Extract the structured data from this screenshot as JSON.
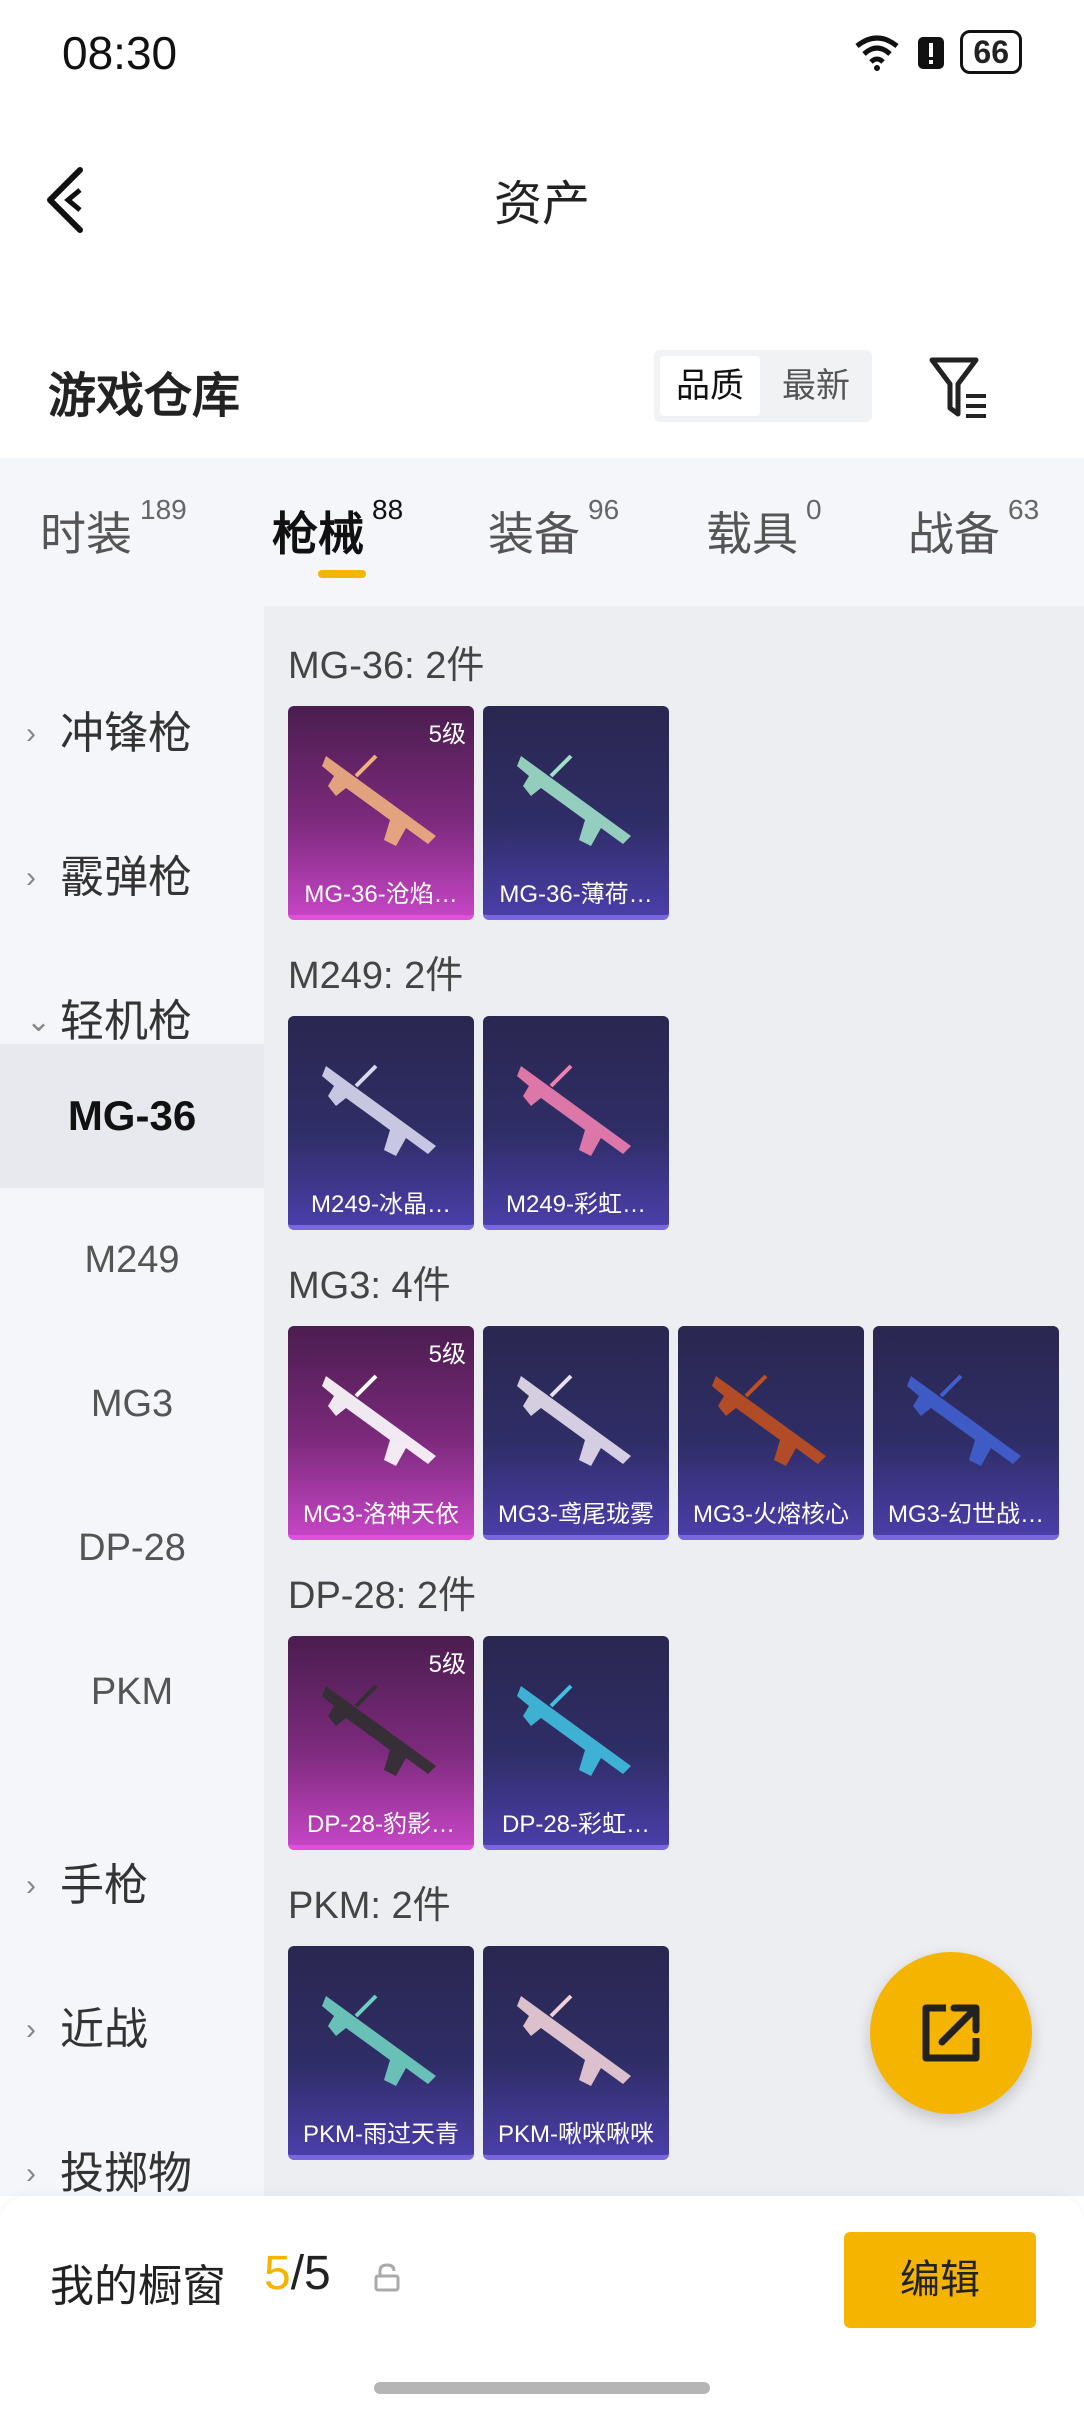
{
  "status_bar": {
    "time": "08:30",
    "battery": "66"
  },
  "header": {
    "title": "资产"
  },
  "store": {
    "title": "游戏仓库",
    "sort_options": [
      "品质",
      "最新"
    ],
    "active_sort": "品质"
  },
  "tabs": [
    {
      "label": "时装",
      "count": "189"
    },
    {
      "label": "枪械",
      "count": "88"
    },
    {
      "label": "装备",
      "count": "96"
    },
    {
      "label": "载具",
      "count": "0"
    },
    {
      "label": "战备",
      "count": "63"
    }
  ],
  "active_tab": "枪械",
  "sidebar": {
    "categories_top": [
      "冲锋枪",
      "霰弹枪",
      "轻机枪"
    ],
    "subs": [
      "MG-36",
      "M249",
      "MG3",
      "DP-28",
      "PKM"
    ],
    "active_sub": "MG-36",
    "categories_bottom": [
      "手枪",
      "近战",
      "投掷物"
    ]
  },
  "groups": [
    {
      "title": "MG-36: 2件",
      "items": [
        {
          "name": "MG-36-沧焰…",
          "level": "5级",
          "quality": "gold"
        },
        {
          "name": "MG-36-薄荷…",
          "level": "",
          "quality": "purple"
        }
      ]
    },
    {
      "title": "M249: 2件",
      "items": [
        {
          "name": "M249-冰晶…",
          "level": "",
          "quality": "purple"
        },
        {
          "name": "M249-彩虹…",
          "level": "",
          "quality": "purple"
        }
      ]
    },
    {
      "title": "MG3: 4件",
      "items": [
        {
          "name": "MG3-洛神天依",
          "level": "5级",
          "quality": "gold"
        },
        {
          "name": "MG3-鸢尾珑雾",
          "level": "",
          "quality": "purple"
        },
        {
          "name": "MG3-火熔核心",
          "level": "",
          "quality": "purple"
        },
        {
          "name": "MG3-幻世战…",
          "level": "",
          "quality": "purple"
        }
      ]
    },
    {
      "title": "DP-28: 2件",
      "items": [
        {
          "name": "DP-28-豹影…",
          "level": "5级",
          "quality": "gold"
        },
        {
          "name": "DP-28-彩虹…",
          "level": "",
          "quality": "purple"
        }
      ]
    },
    {
      "title": "PKM: 2件",
      "items": [
        {
          "name": "PKM-雨过天青",
          "level": "",
          "quality": "purple"
        },
        {
          "name": "PKM-啾咪啾咪",
          "level": "",
          "quality": "purple"
        }
      ]
    }
  ],
  "showcase": {
    "label": "我的橱窗",
    "current": "5",
    "sep": "/",
    "total": "5"
  },
  "edit_label": "编辑",
  "colors": {
    "accent": "#f5b400",
    "gold_card": "#c445c4",
    "purple_card": "#4a3ea8"
  }
}
